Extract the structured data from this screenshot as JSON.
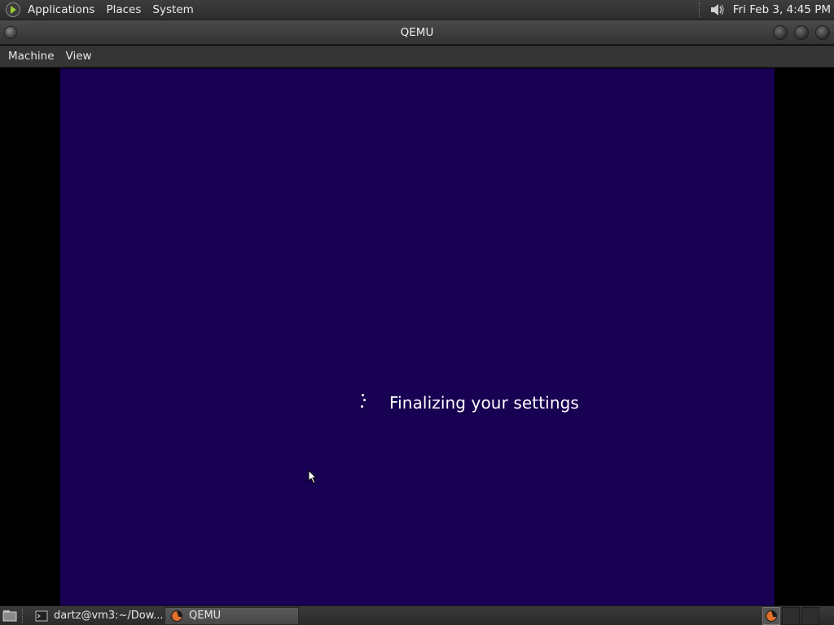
{
  "top_panel": {
    "menus": [
      "Applications",
      "Places",
      "System"
    ],
    "clock": "Fri Feb  3,  4:45 PM",
    "apps_icon": "gnome-foot-icon",
    "volume_icon": "speaker-icon"
  },
  "window": {
    "title": "QEMU",
    "menubar": [
      "Machine",
      "View"
    ]
  },
  "vm": {
    "message": "Finalizing your settings",
    "background": "#180052",
    "spinner_icon": "loading-dots-icon"
  },
  "taskbar": {
    "tasks": [
      {
        "label": "dartz@vm3:~/Dow...",
        "icon": "terminal-icon",
        "active": false
      },
      {
        "label": "QEMU",
        "icon": "qemu-icon",
        "active": true
      }
    ]
  }
}
